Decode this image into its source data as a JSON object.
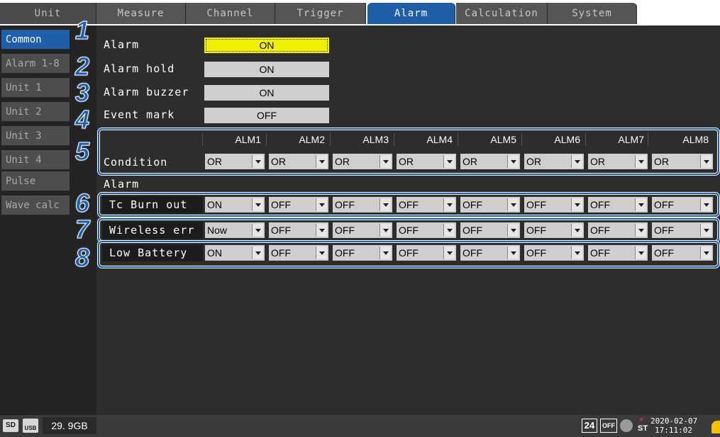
{
  "tabs": {
    "unit": "Unit",
    "items": [
      "Measure",
      "Channel",
      "Trigger",
      "Alarm",
      "Calculation",
      "System"
    ],
    "active": "Alarm"
  },
  "sidebar": {
    "items": [
      "Common",
      "Alarm 1-8",
      "Unit 1",
      "Unit 2",
      "Unit 3",
      "Unit 4",
      "Pulse",
      "Wave calc"
    ],
    "active": "Common"
  },
  "numbers": [
    "1",
    "2",
    "3",
    "4",
    "5",
    "6",
    "7",
    "8"
  ],
  "settings": [
    {
      "label": "Alarm",
      "value": "ON"
    },
    {
      "label": "Alarm hold",
      "value": "ON"
    },
    {
      "label": "Alarm buzzer",
      "value": "ON"
    },
    {
      "label": "Event mark",
      "value": "OFF"
    }
  ],
  "alarm_headers": [
    "ALM1",
    "ALM2",
    "ALM3",
    "ALM4",
    "ALM5",
    "ALM6",
    "ALM7",
    "ALM8"
  ],
  "condition": {
    "label": "Condition",
    "values": [
      "OR",
      "OR",
      "OR",
      "OR",
      "OR",
      "OR",
      "OR",
      "OR"
    ]
  },
  "section_label": "Alarm",
  "rows": [
    {
      "label": "Tc Burn out",
      "values": [
        "ON",
        "OFF",
        "OFF",
        "OFF",
        "OFF",
        "OFF",
        "OFF",
        "OFF"
      ]
    },
    {
      "label": "Wireless err",
      "values": [
        "Now",
        "OFF",
        "OFF",
        "OFF",
        "OFF",
        "OFF",
        "OFF",
        "OFF"
      ]
    },
    {
      "label": "Low Battery",
      "values": [
        "ON",
        "OFF",
        "OFF",
        "OFF",
        "OFF",
        "OFF",
        "OFF",
        "OFF"
      ]
    }
  ],
  "status": {
    "sd": "SD",
    "usb": "USB",
    "storage": "29. 9GB",
    "hours": "24",
    "off": "OFF",
    "date": "2020-02-07",
    "st": "ST",
    "time": "17:11:02"
  },
  "colors": {
    "accent": "#1f5ea8",
    "highlight": "#f0f000",
    "panel": "#2d2d2d"
  }
}
